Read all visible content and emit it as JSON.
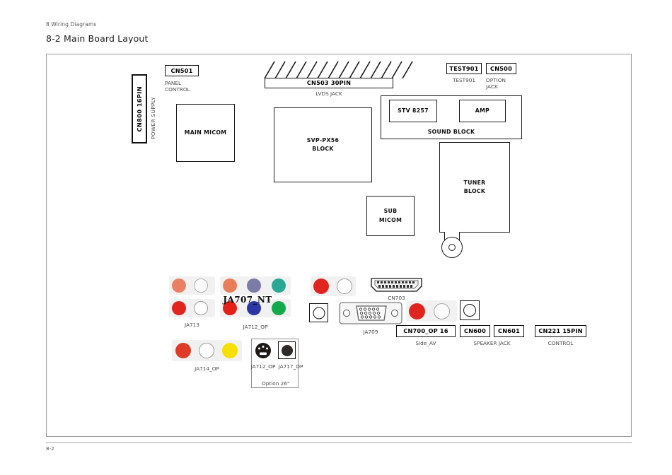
{
  "header": {
    "chapter": "8 Wiring Diagrams",
    "title": "8-2 Main Board Layout"
  },
  "footer": {
    "page_number": "8-2"
  },
  "diagram": {
    "power_supply": {
      "connector": "CN800 16PIN",
      "caption": "POWER SUPPLY"
    },
    "panel_control": {
      "connector": "CN501",
      "caption_line1": "PANEL",
      "caption_line2": "CONTROL"
    },
    "lvds": {
      "connector": "CN503 30PIN",
      "caption": "LVDS JACK",
      "hatch_count": 14
    },
    "test_point": {
      "connector": "TEST901",
      "caption": "TEST901"
    },
    "option_jack": {
      "connector": "CN500",
      "caption_line1": "OPTION",
      "caption_line2": "JACK"
    },
    "blocks": {
      "main_micom": "MAIN MICOM",
      "svp_block_line1": "SVP-PX56",
      "svp_block_line2": "BLOCK",
      "sub_micom_line1": "SUB",
      "sub_micom_line2": "MICOM",
      "tuner_line1": "TUNER",
      "tuner_line2": "BLOCK",
      "sound_block": "SOUND BLOCK",
      "stv": "STV 8257",
      "amp": "AMP"
    },
    "jack_groups": [
      {
        "id": "ja713",
        "label": "JA713",
        "top_row": [
          {
            "name": "rca-red-faded",
            "color": "#e8603c",
            "opacity": 0.78,
            "filled": true
          },
          {
            "name": "rca-white",
            "color": "#ffffff",
            "opacity": 1,
            "filled": false
          }
        ],
        "bottom_row": [
          {
            "name": "rca-red",
            "color": "#e02521",
            "opacity": 1,
            "filled": true
          },
          {
            "name": "rca-white",
            "color": "#ffffff",
            "opacity": 1,
            "filled": false
          }
        ]
      },
      {
        "id": "ja712_op",
        "label": "JA712_OP",
        "overlay_label": "JA707_NT",
        "top_row": [
          {
            "name": "rca-orange-faded",
            "color": "#e8693f",
            "opacity": 0.85,
            "filled": true
          },
          {
            "name": "rca-purple-faded",
            "color": "#6d6e9e",
            "opacity": 0.9,
            "filled": true
          },
          {
            "name": "rca-teal-faded",
            "color": "#13a08c",
            "opacity": 0.9,
            "filled": true
          }
        ],
        "bottom_row": [
          {
            "name": "rca-red",
            "color": "#e32119",
            "opacity": 1,
            "filled": true
          },
          {
            "name": "rca-blue",
            "color": "#2a37a5",
            "opacity": 1,
            "filled": true
          },
          {
            "name": "rca-green",
            "color": "#12a94a",
            "opacity": 1,
            "filled": true
          }
        ]
      },
      {
        "id": "ja714_op",
        "label": "JA714_OP",
        "row": [
          {
            "name": "rca-red",
            "color": "#df3c28",
            "opacity": 1,
            "filled": true
          },
          {
            "name": "rca-white",
            "color": "#ffffff",
            "opacity": 1,
            "filled": false
          },
          {
            "name": "rca-yellow",
            "color": "#f7e000",
            "opacity": 1,
            "filled": true
          }
        ]
      }
    ],
    "av_jacks": {
      "label_pair_red": "rca-red",
      "label_pair_white": "rca-white",
      "color_red": "#e02521"
    },
    "cn703": {
      "caption": "CN703"
    },
    "ja709": {
      "caption": "JA709"
    },
    "side_av": {
      "connector": "CN700_OP 16",
      "caption": "Side_AV"
    },
    "speaker": {
      "connector_left": "CN600",
      "connector_right": "CN601",
      "caption": "SPEAKER JACK"
    },
    "control": {
      "connector": "CN221 15PIN",
      "caption": "CONTROL"
    },
    "option26": {
      "label": "Option 26\"",
      "svideo_caption": "JA712_OP",
      "jack_caption": "JA717_OP"
    }
  }
}
